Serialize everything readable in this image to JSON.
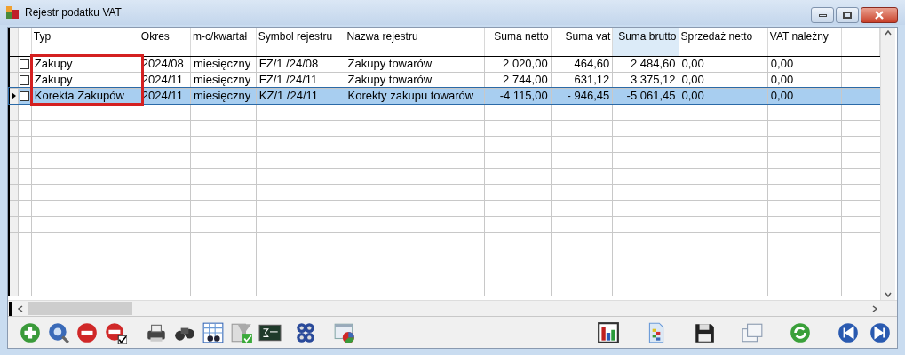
{
  "window": {
    "title": "Rejestr podatku VAT"
  },
  "columns": [
    {
      "label": "Typ",
      "sorted": false
    },
    {
      "label": "Okres",
      "sorted": false
    },
    {
      "label": "m-c/kwartał",
      "sorted": false
    },
    {
      "label": "Symbol rejestru",
      "sorted": false
    },
    {
      "label": "Nazwa rejestru",
      "sorted": false
    },
    {
      "label": "Suma  netto",
      "sorted": false
    },
    {
      "label": "Suma  vat",
      "sorted": false
    },
    {
      "label": "Suma  brutto",
      "sorted": true
    },
    {
      "label": "Sprzedaż netto",
      "sorted": false
    },
    {
      "label": "VAT należny",
      "sorted": false
    }
  ],
  "rows": [
    {
      "selected": false,
      "checked": false,
      "cells": [
        "Zakupy",
        "2024/08",
        "miesięczny",
        "FZ/1  /24/08",
        "Zakupy towarów",
        "2 020,00",
        "464,60",
        "2 484,60",
        "0,00",
        "0,00"
      ]
    },
    {
      "selected": false,
      "checked": false,
      "cells": [
        "Zakupy",
        "2024/11",
        "miesięczny",
        "FZ/1  /24/11",
        "Zakupy towarów",
        "2 744,00",
        "631,12",
        "3 375,12",
        "0,00",
        "0,00"
      ]
    },
    {
      "selected": true,
      "checked": false,
      "cells": [
        "Korekta Zakupów",
        "2024/11",
        "miesięczny",
        "KZ/1  /24/11",
        "Korekty zakupu towarów",
        "-4 115,00",
        "- 946,45",
        "-5 061,45",
        "0,00",
        "0,00"
      ]
    }
  ]
}
